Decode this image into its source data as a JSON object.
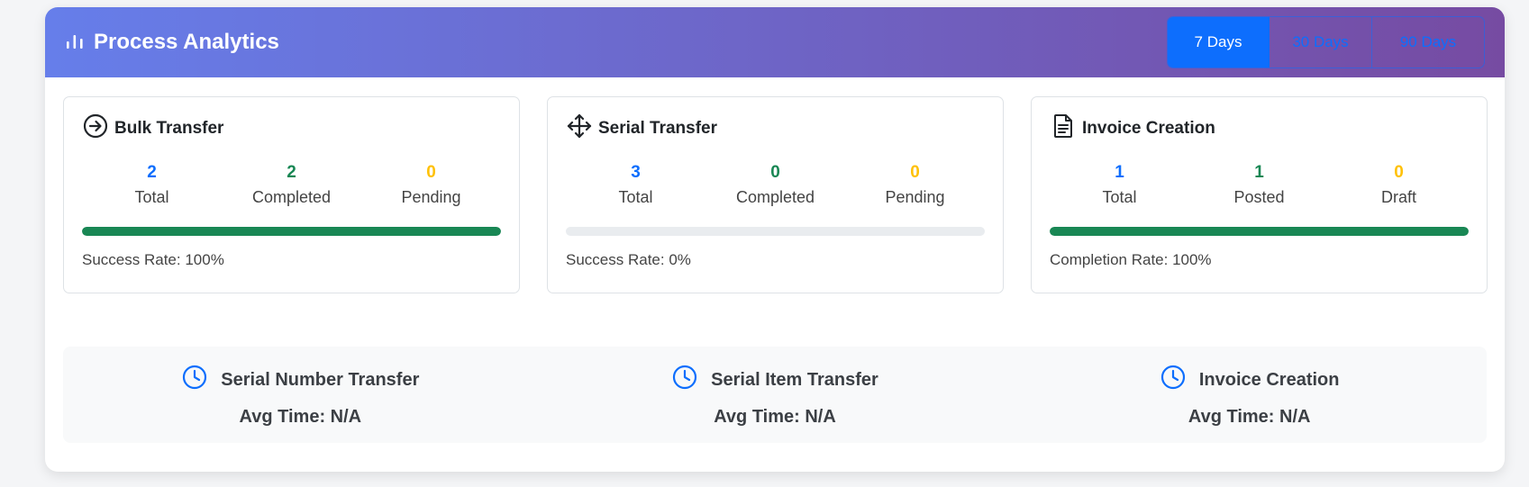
{
  "header": {
    "title": "Process Analytics",
    "icon": "bar-chart-icon",
    "ranges": [
      {
        "label": "7 Days",
        "active": true
      },
      {
        "label": "30 Days",
        "active": false
      },
      {
        "label": "90 Days",
        "active": false
      }
    ]
  },
  "cards": [
    {
      "title": "Bulk Transfer",
      "icon": "arrow-right-circle-icon",
      "stats": [
        {
          "value": "2",
          "label": "Total"
        },
        {
          "value": "2",
          "label": "Completed"
        },
        {
          "value": "0",
          "label": "Pending"
        }
      ],
      "progress_percent": 100,
      "rate_text": "Success Rate: 100%"
    },
    {
      "title": "Serial Transfer",
      "icon": "move-arrows-icon",
      "stats": [
        {
          "value": "3",
          "label": "Total"
        },
        {
          "value": "0",
          "label": "Completed"
        },
        {
          "value": "0",
          "label": "Pending"
        }
      ],
      "progress_percent": 0,
      "rate_text": "Success Rate: 0%"
    },
    {
      "title": "Invoice Creation",
      "icon": "document-icon",
      "stats": [
        {
          "value": "1",
          "label": "Total"
        },
        {
          "value": "1",
          "label": "Posted"
        },
        {
          "value": "0",
          "label": "Draft"
        }
      ],
      "progress_percent": 100,
      "rate_text": "Completion Rate: 100%"
    }
  ],
  "timings": [
    {
      "title": "Serial Number Transfer",
      "value": "Avg Time: N/A",
      "icon": "clock-icon"
    },
    {
      "title": "Serial Item Transfer",
      "value": "Avg Time: N/A",
      "icon": "clock-icon"
    },
    {
      "title": "Invoice Creation",
      "value": "Avg Time: N/A",
      "icon": "clock-icon"
    }
  ],
  "colors": {
    "header_gradient_start": "#667eea",
    "header_gradient_end": "#764ba2",
    "primary": "#0d6efd",
    "success": "#198754",
    "warning": "#ffc107"
  }
}
